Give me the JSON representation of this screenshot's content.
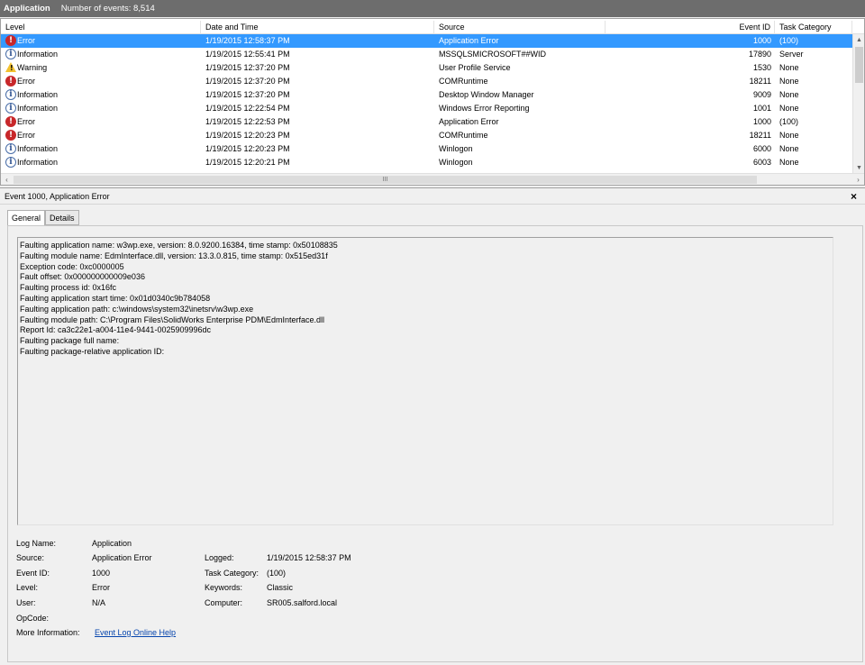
{
  "titlebar": {
    "name": "Application",
    "count": "Number of events: 8,514"
  },
  "grid": {
    "columns": [
      "Level",
      "Date and Time",
      "Source",
      "Event ID",
      "Task Category"
    ],
    "rows": [
      {
        "level": "Error",
        "type": "error",
        "date": "1/19/2015 12:58:37 PM",
        "source": "Application Error",
        "id": "1000",
        "category": "(100)",
        "selected": true
      },
      {
        "level": "Information",
        "type": "info",
        "date": "1/19/2015 12:55:41 PM",
        "source": "MSSQLSMICROSOFT##WID",
        "id": "17890",
        "category": "Server"
      },
      {
        "level": "Warning",
        "type": "warning",
        "date": "1/19/2015 12:37:20 PM",
        "source": "User Profile Service",
        "id": "1530",
        "category": "None"
      },
      {
        "level": "Error",
        "type": "error",
        "date": "1/19/2015 12:37:20 PM",
        "source": "COMRuntime",
        "id": "18211",
        "category": "None"
      },
      {
        "level": "Information",
        "type": "info",
        "date": "1/19/2015 12:37:20 PM",
        "source": "Desktop Window Manager",
        "id": "9009",
        "category": "None"
      },
      {
        "level": "Information",
        "type": "info",
        "date": "1/19/2015 12:22:54 PM",
        "source": "Windows Error Reporting",
        "id": "1001",
        "category": "None"
      },
      {
        "level": "Error",
        "type": "error",
        "date": "1/19/2015 12:22:53 PM",
        "source": "Application Error",
        "id": "1000",
        "category": "(100)"
      },
      {
        "level": "Error",
        "type": "error",
        "date": "1/19/2015 12:20:23 PM",
        "source": "COMRuntime",
        "id": "18211",
        "category": "None"
      },
      {
        "level": "Information",
        "type": "info",
        "date": "1/19/2015 12:20:23 PM",
        "source": "Winlogon",
        "id": "6000",
        "category": "None"
      },
      {
        "level": "Information",
        "type": "info",
        "date": "1/19/2015 12:20:21 PM",
        "source": "Winlogon",
        "id": "6003",
        "category": "None"
      }
    ],
    "hscroll_grip": "III"
  },
  "detail": {
    "title": "Event 1000, Application Error",
    "close": "×",
    "tabs": [
      "General",
      "Details"
    ],
    "description": [
      "Faulting application name: w3wp.exe, version: 8.0.9200.16384, time stamp: 0x50108835",
      "Faulting module name: EdmInterface.dll, version: 13.3.0.815, time stamp: 0x515ed31f",
      "Exception code: 0xc0000005",
      "Fault offset: 0x000000000009e036",
      "Faulting process id: 0x16fc",
      "Faulting application start time: 0x01d0340c9b784058",
      "Faulting application path: c:\\windows\\system32\\inetsrv\\w3wp.exe",
      "Faulting module path: C:\\Program Files\\SolidWorks Enterprise PDM\\EdmInterface.dll",
      "Report Id: ca3c22e1-a004-11e4-9441-0025909996dc",
      "Faulting package full name:",
      "Faulting package-relative application ID:"
    ],
    "props": {
      "log_name_label": "Log Name:",
      "log_name": "Application",
      "source_label": "Source:",
      "source": "Application Error",
      "logged_label": "Logged:",
      "logged": "1/19/2015 12:58:37 PM",
      "event_id_label": "Event ID:",
      "event_id": "1000",
      "task_category_label": "Task Category:",
      "task_category": "(100)",
      "level_label": "Level:",
      "level": "Error",
      "keywords_label": "Keywords:",
      "keywords": "Classic",
      "user_label": "User:",
      "user": "N/A",
      "computer_label": "Computer:",
      "computer": "SR005.salford.local",
      "opcode_label": "OpCode:",
      "more_info_label": "More Information:",
      "more_info_link": "Event Log Online Help"
    }
  }
}
